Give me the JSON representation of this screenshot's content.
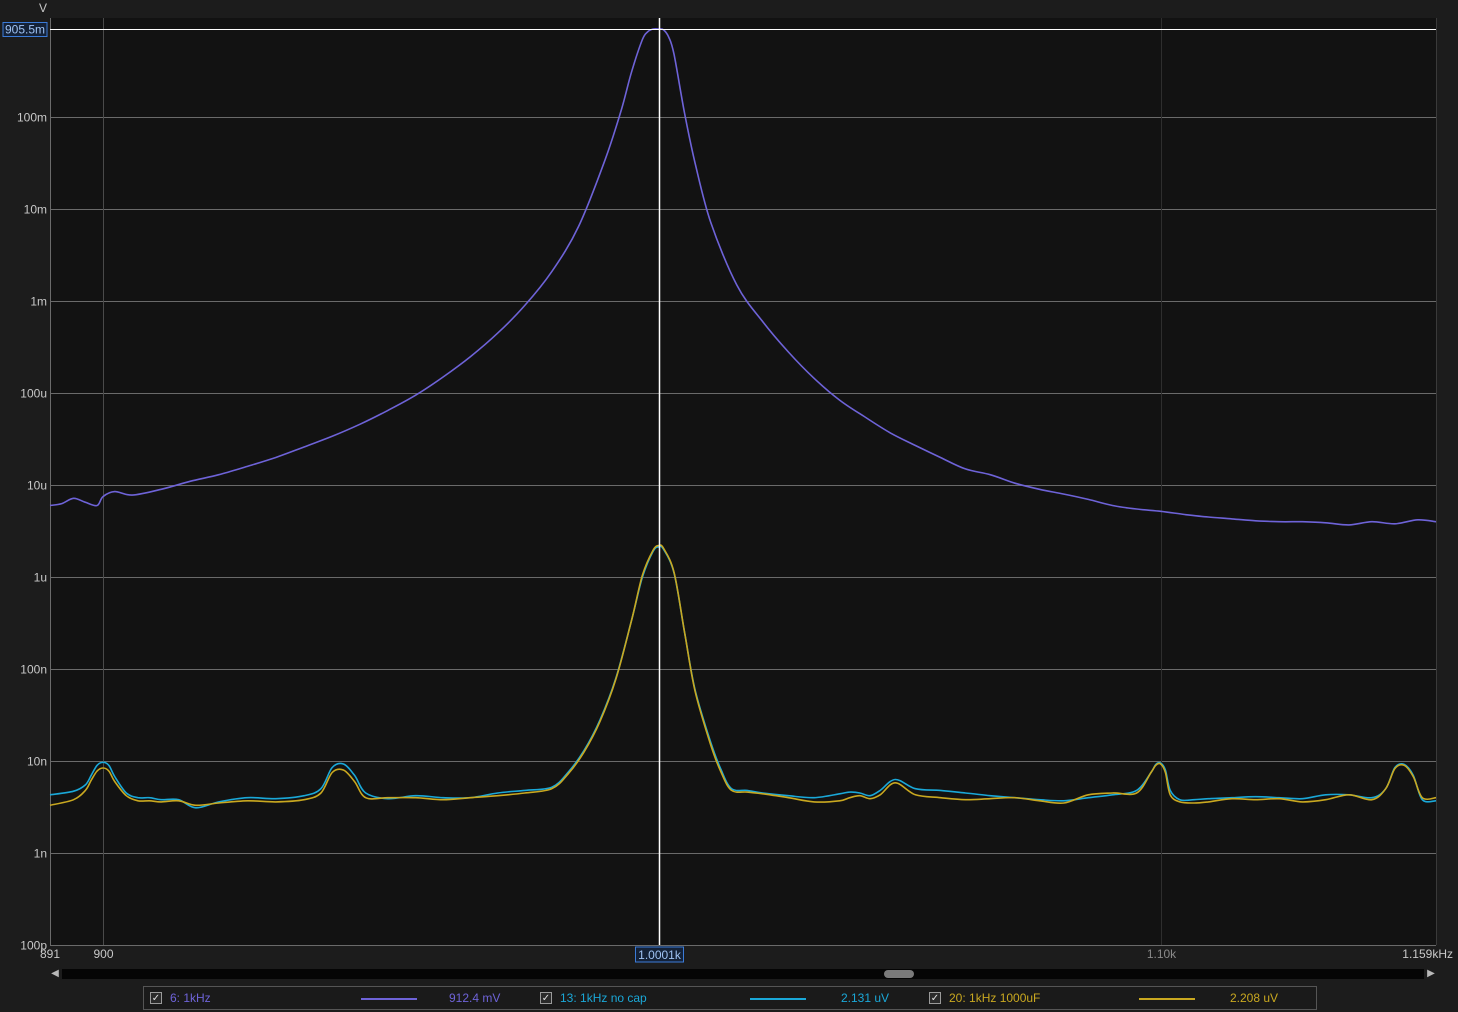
{
  "chart_data": {
    "type": "line",
    "x_scale": "log",
    "y_scale": "log",
    "xlim": [
      891,
      1159
    ],
    "ylim": [
      1e-10,
      1.2
    ],
    "y_unit_label": "V",
    "x_min_label": "891",
    "x_max_label": "1.159kHz",
    "x_ticks": [
      {
        "value": 900,
        "label": "900",
        "major": true
      },
      {
        "value": 1100,
        "label": "1.10k",
        "major": false
      }
    ],
    "y_ticks": [
      {
        "value": 0.1,
        "label": "100m"
      },
      {
        "value": 0.01,
        "label": "10m"
      },
      {
        "value": 0.001,
        "label": "1m"
      },
      {
        "value": 0.0001,
        "label": "100u"
      },
      {
        "value": 1e-05,
        "label": "10u"
      },
      {
        "value": 1e-06,
        "label": "1u"
      },
      {
        "value": 1e-07,
        "label": "100n"
      },
      {
        "value": 1e-08,
        "label": "10n"
      },
      {
        "value": 1e-09,
        "label": "1n"
      },
      {
        "value": 1e-10,
        "label": "100p"
      }
    ],
    "cursor": {
      "x": 1000.1,
      "x_label": "1.0001k",
      "y": 0.9055,
      "y_label": "905.5m"
    },
    "series": [
      {
        "name": "6: 1kHz",
        "color": "#6e63d8",
        "cursor_value": "912.4 mV",
        "x": [
          891,
          893,
          895,
          897,
          899,
          900,
          902,
          905,
          910,
          915,
          920,
          925,
          930,
          935,
          940,
          945,
          950,
          955,
          960,
          965,
          970,
          975,
          980,
          985,
          990,
          993,
          995,
          997,
          998,
          999,
          1000.1,
          1001,
          1002,
          1003,
          1005,
          1007,
          1010,
          1015,
          1020,
          1025,
          1030,
          1035,
          1040,
          1045,
          1050,
          1055,
          1060,
          1065,
          1070,
          1075,
          1080,
          1085,
          1090,
          1095,
          1100,
          1105,
          1110,
          1115,
          1120,
          1125,
          1130,
          1135,
          1140,
          1145,
          1150,
          1155,
          1159
        ],
        "y": [
          6e-06,
          6.3e-06,
          7.2e-06,
          6.5e-06,
          6e-06,
          7.5e-06,
          8.5e-06,
          7.8e-06,
          9e-06,
          1.1e-05,
          1.3e-05,
          1.6e-05,
          2e-05,
          2.6e-05,
          3.4e-05,
          4.6e-05,
          6.5e-05,
          9.5e-05,
          0.00015,
          0.00025,
          0.00045,
          0.0009,
          0.0021,
          0.0065,
          0.035,
          0.12,
          0.32,
          0.7,
          0.85,
          0.91,
          0.912,
          0.89,
          0.74,
          0.48,
          0.11,
          0.032,
          0.0072,
          0.0015,
          0.0006,
          0.00028,
          0.000145,
          8.4e-05,
          5.5e-05,
          3.7e-05,
          2.7e-05,
          2e-05,
          1.5e-05,
          1.3e-05,
          1.05e-05,
          9e-06,
          8e-06,
          7e-06,
          6e-06,
          5.5e-06,
          5.2e-06,
          4.8e-06,
          4.5e-06,
          4.3e-06,
          4.1e-06,
          4e-06,
          4e-06,
          3.9e-06,
          3.7e-06,
          4e-06,
          3.8e-06,
          4.2e-06,
          4e-06
        ]
      },
      {
        "name": "13: 1kHz no cap",
        "color": "#1aa8d8",
        "cursor_value": "2.131 uV",
        "x": [
          891,
          895,
          897,
          898,
          899,
          900,
          901,
          902,
          904,
          906,
          908,
          910,
          913,
          916,
          920,
          925,
          930,
          935,
          938,
          940,
          942,
          944,
          946,
          950,
          955,
          960,
          965,
          970,
          975,
          980,
          983,
          986,
          989,
          992,
          995,
          997,
          999,
          1000.1,
          1001,
          1003,
          1005,
          1007,
          1010,
          1012,
          1014,
          1017,
          1020,
          1025,
          1030,
          1035,
          1037,
          1039,
          1041,
          1043,
          1046,
          1050,
          1055,
          1060,
          1065,
          1070,
          1075,
          1080,
          1085,
          1090,
          1095,
          1098,
          1099,
          1100,
          1101,
          1102,
          1104,
          1107,
          1110,
          1115,
          1120,
          1125,
          1130,
          1135,
          1140,
          1145,
          1148,
          1150,
          1152,
          1154,
          1156,
          1159
        ],
        "y": [
          4.3e-09,
          4.7e-09,
          5.5e-09,
          7e-09,
          9e-09,
          9.7e-09,
          9e-09,
          6.8e-09,
          4.5e-09,
          4e-09,
          4e-09,
          3.8e-09,
          3.8e-09,
          3.1e-09,
          3.6e-09,
          4e-09,
          3.9e-09,
          4.2e-09,
          5e-09,
          8.5e-09,
          9.3e-09,
          7e-09,
          4.5e-09,
          3.9e-09,
          4.2e-09,
          4e-09,
          4e-09,
          4.5e-09,
          4.8e-09,
          5.2e-09,
          7.5e-09,
          1.3e-08,
          2.8e-08,
          8e-08,
          3.5e-07,
          1e-06,
          1.9e-06,
          2.131e-06,
          2e-06,
          1.1e-06,
          2.5e-07,
          6e-08,
          1.6e-08,
          8e-09,
          5e-09,
          4.8e-09,
          4.5e-09,
          4.2e-09,
          4e-09,
          4.4e-09,
          4.6e-09,
          4.5e-09,
          4.2e-09,
          4.8e-09,
          6.3e-09,
          5e-09,
          4.8e-09,
          4.5e-09,
          4.2e-09,
          4e-09,
          3.8e-09,
          3.7e-09,
          4e-09,
          4.3e-09,
          4.8e-09,
          7.5e-09,
          9.2e-09,
          9.5e-09,
          8e-09,
          4.8e-09,
          3.8e-09,
          3.8e-09,
          3.9e-09,
          4e-09,
          4.1e-09,
          4e-09,
          3.9e-09,
          4.3e-09,
          4.3e-09,
          4e-09,
          5e-09,
          8.5e-09,
          9.2e-09,
          7e-09,
          3.8e-09,
          3.7e-09
        ]
      },
      {
        "name": "20: 1kHz 1000uF",
        "color": "#c9a820",
        "cursor_value": "2.208 uV",
        "x": [
          891,
          895,
          897,
          898,
          899,
          900,
          901,
          902,
          904,
          906,
          908,
          910,
          913,
          916,
          920,
          925,
          930,
          935,
          938,
          940,
          942,
          944,
          946,
          950,
          955,
          960,
          965,
          970,
          975,
          980,
          983,
          986,
          989,
          992,
          995,
          997,
          999,
          1000.1,
          1001,
          1003,
          1005,
          1007,
          1010,
          1012,
          1014,
          1017,
          1020,
          1025,
          1030,
          1035,
          1037,
          1039,
          1041,
          1043,
          1046,
          1050,
          1055,
          1060,
          1065,
          1070,
          1075,
          1080,
          1085,
          1090,
          1095,
          1098,
          1099,
          1100,
          1101,
          1102,
          1104,
          1107,
          1110,
          1115,
          1120,
          1125,
          1130,
          1135,
          1140,
          1145,
          1148,
          1150,
          1152,
          1154,
          1156,
          1159
        ],
        "y": [
          3.3e-09,
          3.8e-09,
          4.8e-09,
          6.2e-09,
          7.8e-09,
          8.4e-09,
          7.8e-09,
          6e-09,
          4.2e-09,
          3.7e-09,
          3.7e-09,
          3.6e-09,
          3.7e-09,
          3.3e-09,
          3.5e-09,
          3.7e-09,
          3.6e-09,
          3.8e-09,
          4.5e-09,
          7.5e-09,
          8e-09,
          6e-09,
          4e-09,
          4e-09,
          4e-09,
          3.8e-09,
          4e-09,
          4.2e-09,
          4.5e-09,
          5e-09,
          7.2e-09,
          1.25e-08,
          2.7e-08,
          7.8e-08,
          3.5e-07,
          1.05e-06,
          1.95e-06,
          2.208e-06,
          2.05e-06,
          1.12e-06,
          2.5e-07,
          5.8e-08,
          1.5e-08,
          7.5e-09,
          4.8e-09,
          4.6e-09,
          4.4e-09,
          4e-09,
          3.6e-09,
          3.7e-09,
          4e-09,
          4.2e-09,
          3.9e-09,
          4.3e-09,
          5.8e-09,
          4.3e-09,
          4e-09,
          3.8e-09,
          3.9e-09,
          4e-09,
          3.7e-09,
          3.5e-09,
          4.3e-09,
          4.5e-09,
          4.5e-09,
          7.5e-09,
          9e-09,
          9.3e-09,
          7.5e-09,
          4.3e-09,
          3.6e-09,
          3.5e-09,
          3.6e-09,
          3.9e-09,
          3.8e-09,
          3.9e-09,
          3.6e-09,
          3.8e-09,
          4.3e-09,
          3.8e-09,
          5e-09,
          8.3e-09,
          9e-09,
          6.8e-09,
          4e-09,
          4e-09
        ]
      }
    ]
  },
  "scrollbar": {
    "left_arrow": "◀",
    "right_arrow": "▶"
  },
  "legend": {
    "check_glyph": "✓"
  }
}
